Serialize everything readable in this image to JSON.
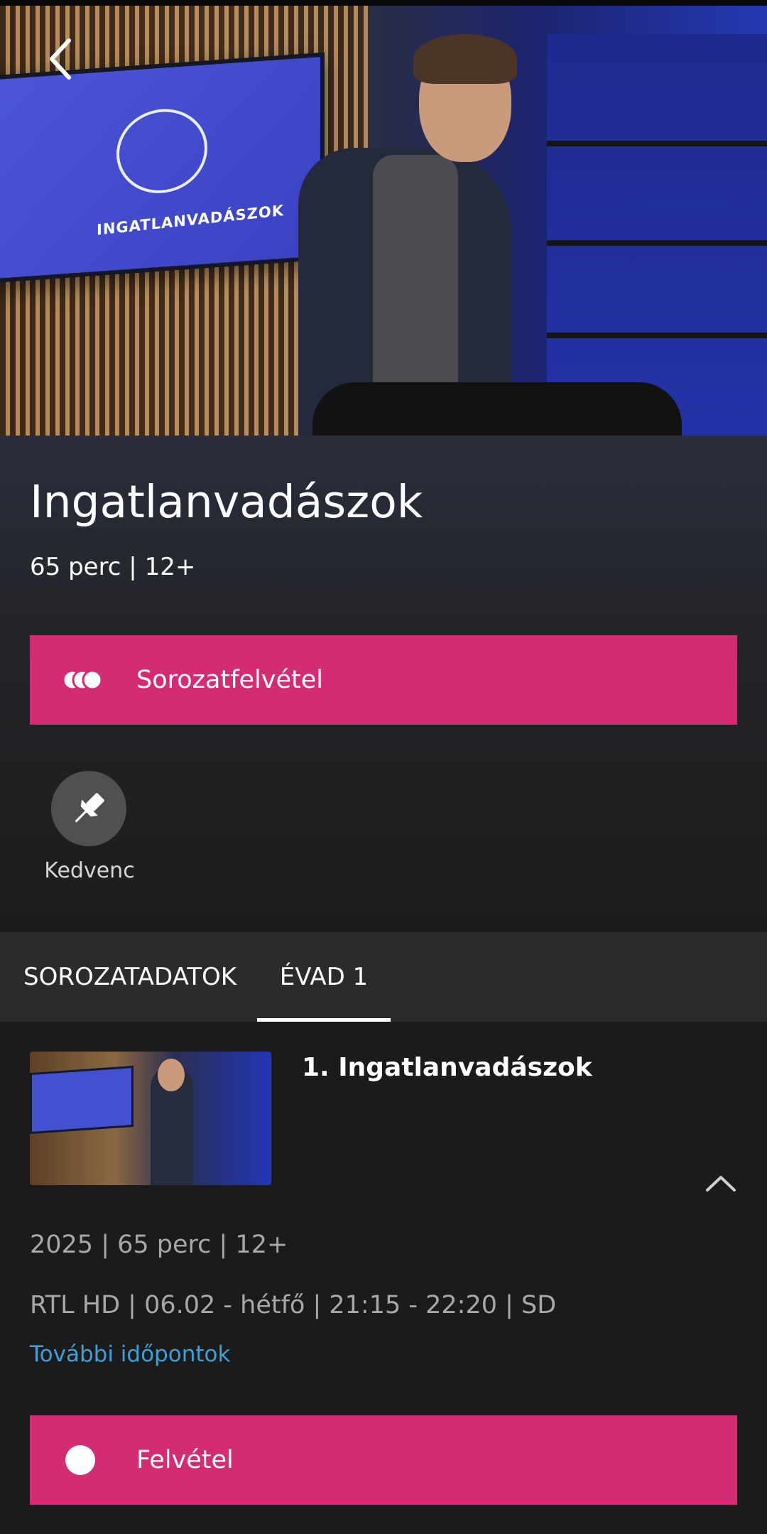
{
  "hero": {
    "image_name": "show-hero-image",
    "tv_logo_text": "INGATLANVADÁSZOK",
    "back_icon": "chevron-left-icon"
  },
  "show": {
    "title": "Ingatlanvadászok",
    "meta": "65 perc | 12+"
  },
  "actions": {
    "series_record_label": "Sorozatfelvétel",
    "series_record_icon": "series-record-icon",
    "favorite_label": "Kedvenc",
    "favorite_icon": "pin-icon"
  },
  "tabs": [
    {
      "label": "SOROZATADATOK",
      "active": false
    },
    {
      "label": "ÉVAD 1",
      "active": true
    }
  ],
  "episode": {
    "title": "1. Ingatlanvadászok",
    "meta": "2025 | 65 perc | 12+",
    "schedule": "RTL HD | 06.02 - hétfő | 21:15 - 22:20 | SD",
    "more_times_label": "További időpontok",
    "record_label": "Felvétel",
    "collapse_icon": "chevron-up-icon"
  },
  "colors": {
    "accent": "#d42c74",
    "link": "#3f9fd8",
    "background": "#1b1b1b",
    "tab_bar": "#2b2b2b"
  }
}
